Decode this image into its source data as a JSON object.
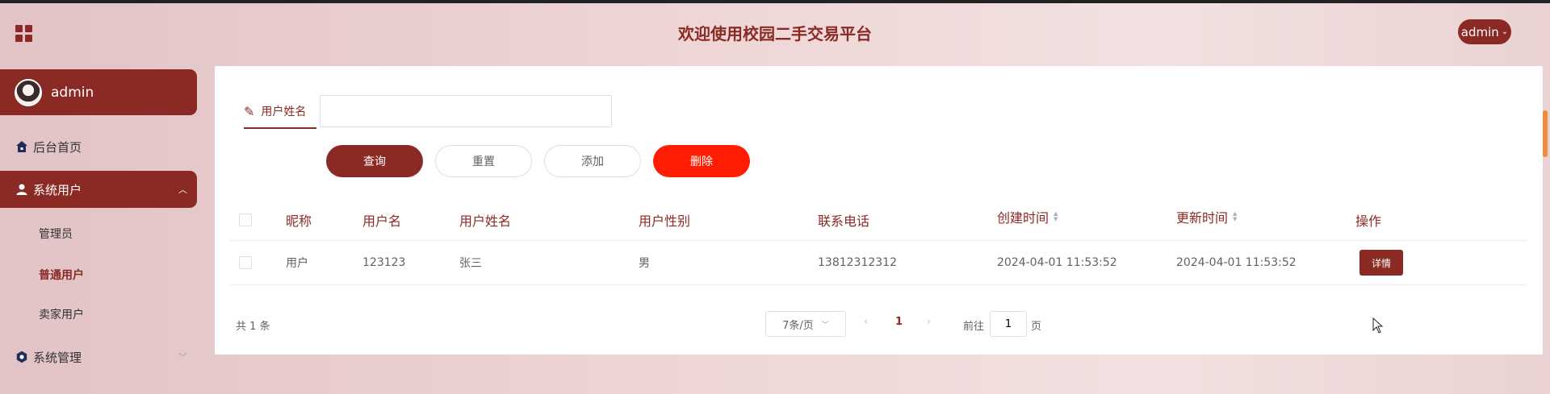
{
  "header": {
    "title": "欢迎使用校园二手交易平台",
    "user_menu_label": "admin"
  },
  "sidebar": {
    "profile_name": "admin",
    "items": [
      {
        "label": "后台首页",
        "icon": "home-icon"
      },
      {
        "label": "系统用户",
        "icon": "user-icon",
        "expanded": true
      },
      {
        "label": "系统管理",
        "icon": "gear-icon",
        "expanded": false
      }
    ],
    "sub_items": [
      "管理员",
      "普通用户",
      "卖家用户"
    ]
  },
  "search": {
    "label": "用户姓名",
    "value": "",
    "placeholder": ""
  },
  "buttons": {
    "query": "查询",
    "reset": "重置",
    "add": "添加",
    "delete": "删除"
  },
  "table": {
    "columns": [
      "昵称",
      "用户名",
      "用户姓名",
      "用户性别",
      "联系电话",
      "创建时间",
      "更新时间",
      "操作"
    ],
    "rows": [
      {
        "nickname": "用户",
        "username": "123123",
        "realname": "张三",
        "gender": "男",
        "phone": "13812312312",
        "created": "2024-04-01 11:53:52",
        "updated": "2024-04-01 11:53:52",
        "action": "详情"
      }
    ]
  },
  "pagination": {
    "total": "共 1 条",
    "page_size": "7条/页",
    "current_page": "1",
    "goto_label": "前往",
    "goto_value": "1",
    "goto_suffix": "页"
  },
  "colors": {
    "primary": "#8b2a24",
    "danger": "#ff1e04"
  }
}
